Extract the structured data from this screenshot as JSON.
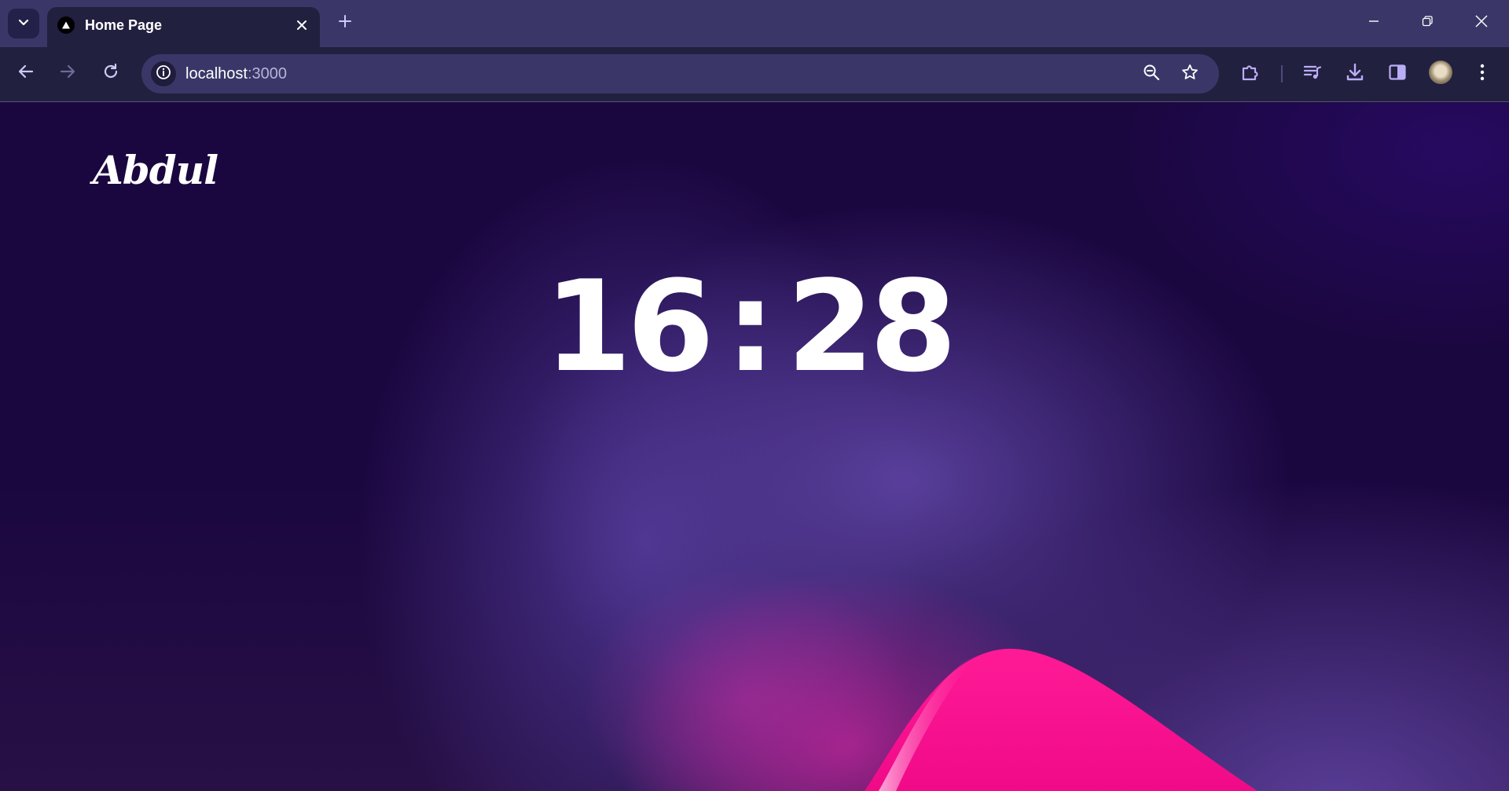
{
  "browser": {
    "tab": {
      "title": "Home Page",
      "favicon": "nextjs-triangle-icon"
    },
    "omnibox": {
      "host": "localhost",
      "port": ":3000"
    },
    "icons": {
      "tab_list": "chevron-down-icon",
      "close_tab": "close-icon",
      "new_tab": "plus-icon",
      "minimize": "minimize-icon",
      "restore": "restore-icon",
      "close_window": "close-icon",
      "back": "arrow-left-icon",
      "forward": "arrow-right-icon",
      "reload": "reload-icon",
      "site_info": "info-icon",
      "zoom": "zoom-out-icon",
      "bookmark": "star-icon",
      "extensions": "puzzle-icon",
      "media": "media-queue-icon",
      "downloads": "download-icon",
      "side_panel": "side-panel-icon",
      "menu": "kebab-menu-icon"
    },
    "colors": {
      "tabbar": "#3a3768",
      "toolbar": "#22203f",
      "accent": "#b9aef5"
    }
  },
  "page": {
    "logo_text": "Abdul",
    "clock": {
      "hours": "16",
      "separator": ":",
      "minutes": "28"
    },
    "colors": {
      "background": "#1a0840",
      "purple_glow": "#5c42a0",
      "pink_wave": "#ff0a8c"
    }
  }
}
